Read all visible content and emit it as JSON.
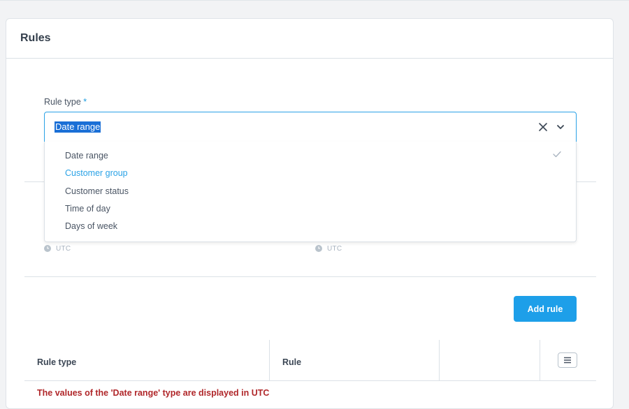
{
  "card": {
    "title": "Rules"
  },
  "rule_type_field": {
    "label": "Rule type",
    "required_mark": "*",
    "selected_value": "Date range"
  },
  "dropdown": {
    "options": [
      {
        "label": "Date range",
        "selected": true
      },
      {
        "label": "Customer group",
        "hovered": true
      },
      {
        "label": "Customer status"
      },
      {
        "label": "Time of day"
      },
      {
        "label": "Days of week"
      }
    ]
  },
  "timezone": {
    "left_label": "UTC",
    "right_label": "UTC"
  },
  "add_rule_button": {
    "label": "Add rule"
  },
  "table": {
    "headers": [
      "Rule type",
      "Rule"
    ],
    "warning": "The values of the 'Date range' type are displayed in UTC"
  },
  "colors": {
    "accent": "#1d9fe9",
    "warning": "#b0272a",
    "selection_highlight": "#1a6fd6"
  },
  "icons": [
    "close-icon",
    "chevron-down-icon",
    "check-icon",
    "clock-icon",
    "menu-icon"
  ]
}
